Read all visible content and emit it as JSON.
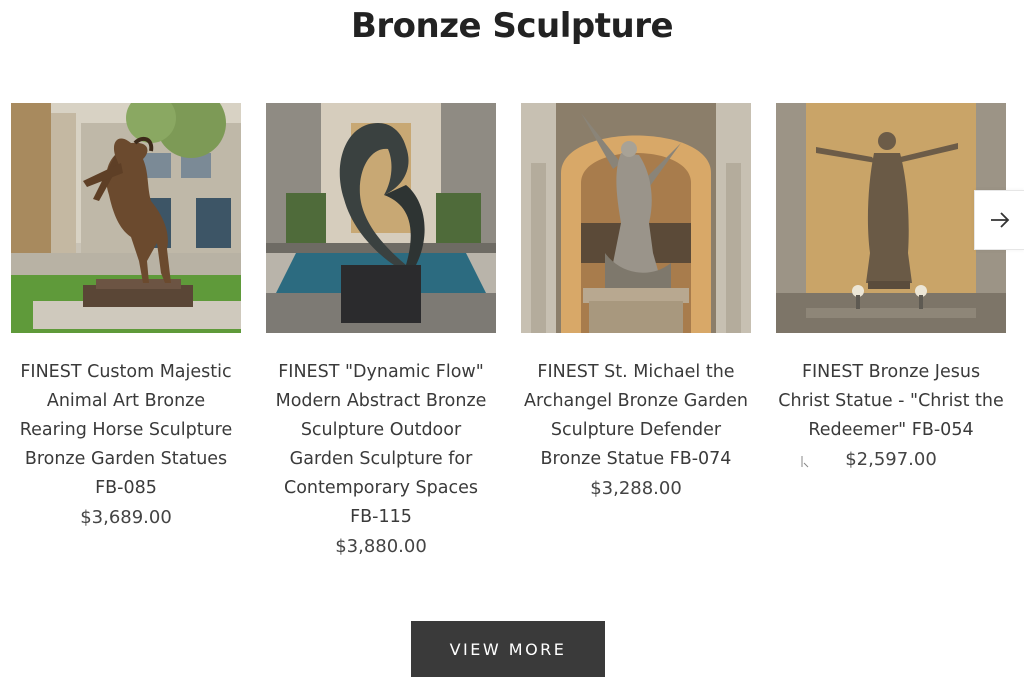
{
  "section": {
    "title": "Bronze Sculpture"
  },
  "products": [
    {
      "title": "FINEST Custom Majestic Animal Art Bronze Rearing Horse Sculpture Bronze Garden Statues FB-085",
      "price": "$3,689.00",
      "image_icon": "rearing-horse-statue-image"
    },
    {
      "title": "FINEST \"Dynamic Flow\" Modern Abstract Bronze Sculpture Outdoor Garden Sculpture for Contemporary Spaces FB-115",
      "price": "$3,880.00",
      "image_icon": "abstract-flow-sculpture-image"
    },
    {
      "title": "FINEST St. Michael the Archangel Bronze Garden Sculpture Defender Bronze Statue FB-074",
      "price": "$3,288.00",
      "image_icon": "archangel-statue-image"
    },
    {
      "title": "FINEST Bronze Jesus Christ Statue - \"Christ the Redeemer\" FB-054",
      "price": "$2,597.00",
      "image_icon": "christ-redeemer-statue-image"
    }
  ],
  "carousel": {
    "next_icon": "arrow-right-icon"
  },
  "actions": {
    "view_more_label": "VIEW MORE"
  },
  "colors": {
    "button_bg": "#3a3a3a",
    "bronze": "#6b4a2e",
    "text": "#3a3a3a"
  }
}
